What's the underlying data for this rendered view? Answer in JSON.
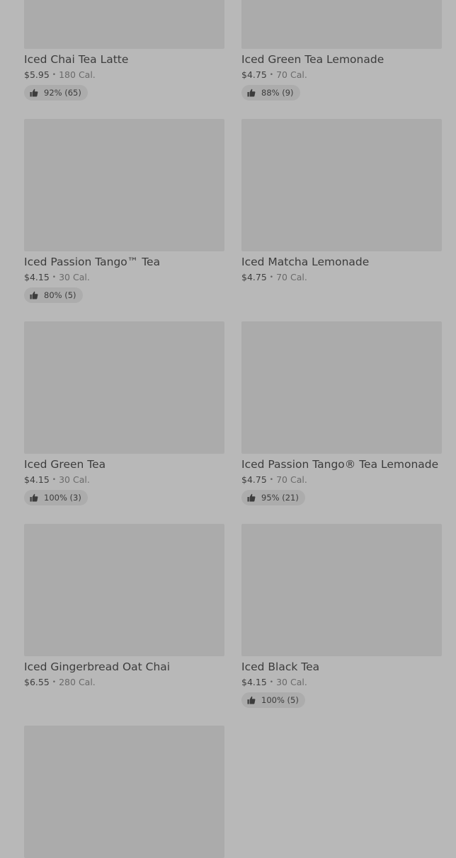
{
  "products": [
    {
      "name": "Iced Chai Tea Latte",
      "price": "$5.95",
      "calories": "180 Cal.",
      "rating": "92% (65)"
    },
    {
      "name": "Iced Green Tea Lemonade",
      "price": "$4.75",
      "calories": "70 Cal.",
      "rating": "88% (9)"
    },
    {
      "name": "Iced Passion Tango™ Tea",
      "price": "$4.15",
      "calories": "30 Cal.",
      "rating": "80% (5)"
    },
    {
      "name": "Iced Matcha Lemonade",
      "price": "$4.75",
      "calories": "70 Cal.",
      "rating": null
    },
    {
      "name": "Iced Green Tea",
      "price": "$4.15",
      "calories": "30 Cal.",
      "rating": "100% (3)"
    },
    {
      "name": "Iced Passion Tango® Tea Lemonade",
      "price": "$4.75",
      "calories": "70 Cal.",
      "rating": "95% (21)"
    },
    {
      "name": "Iced Gingerbread Oat Chai",
      "price": "$6.55",
      "calories": "280 Cal.",
      "rating": null
    },
    {
      "name": "Iced Black Tea",
      "price": "$4.15",
      "calories": "30 Cal.",
      "rating": "100% (5)"
    },
    {
      "name": "",
      "price": "",
      "calories": "",
      "rating": null
    }
  ],
  "separator": "•",
  "colors": {
    "background": "#b8b8b8",
    "thumbnail": "#ababab",
    "badge": "#acacac"
  },
  "icons": {
    "rating": "thumbs-up-icon"
  }
}
